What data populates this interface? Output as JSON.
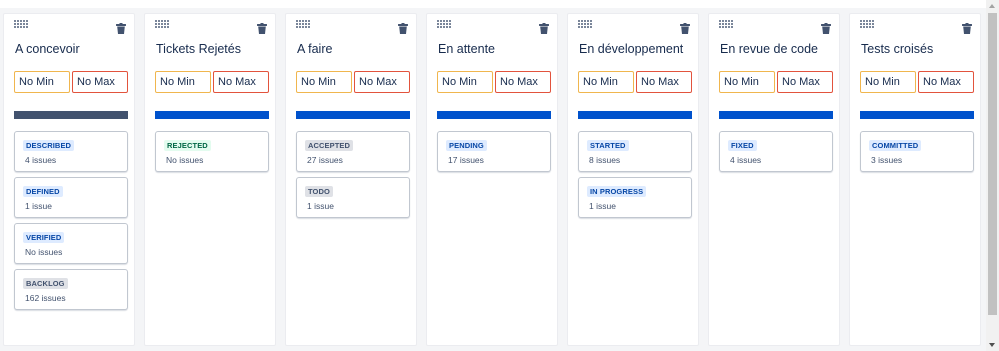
{
  "board": {
    "limit_placeholders": {
      "min": "No Min",
      "max": "No Max"
    },
    "columns": [
      {
        "title": "A concevoir",
        "bar_color": "#42526e",
        "cards": [
          {
            "status": "DESCRIBED",
            "badge": "blue",
            "count": "4 issues"
          },
          {
            "status": "DEFINED",
            "badge": "blue",
            "count": "1 issue"
          },
          {
            "status": "VERIFIED",
            "badge": "blue",
            "count": "No issues"
          },
          {
            "status": "BACKLOG",
            "badge": "gray",
            "count": "162 issues"
          }
        ]
      },
      {
        "title": "Tickets Rejetés",
        "bar_color": "#0052cc",
        "cards": [
          {
            "status": "REJECTED",
            "badge": "green",
            "count": "No issues"
          }
        ]
      },
      {
        "title": "A faire",
        "bar_color": "#0052cc",
        "cards": [
          {
            "status": "ACCEPTED",
            "badge": "gray",
            "count": "27 issues"
          },
          {
            "status": "TODO",
            "badge": "gray",
            "count": "1 issue"
          }
        ]
      },
      {
        "title": "En attente",
        "bar_color": "#0052cc",
        "cards": [
          {
            "status": "PENDING",
            "badge": "blue",
            "count": "17 issues"
          }
        ]
      },
      {
        "title": "En développement",
        "bar_color": "#0052cc",
        "cards": [
          {
            "status": "STARTED",
            "badge": "blue",
            "count": "8 issues"
          },
          {
            "status": "IN PROGRESS",
            "badge": "blue",
            "count": "1 issue"
          }
        ]
      },
      {
        "title": "En revue de code",
        "bar_color": "#0052cc",
        "cards": [
          {
            "status": "FIXED",
            "badge": "blue",
            "count": "4 issues"
          }
        ]
      },
      {
        "title": "Tests croisés",
        "bar_color": "#0052cc",
        "cards": [
          {
            "status": "COMMITTED",
            "badge": "blue",
            "count": "3 issues"
          }
        ]
      }
    ]
  },
  "icons": {
    "grip": "drag-handle-icon",
    "delete": "trash-icon"
  }
}
